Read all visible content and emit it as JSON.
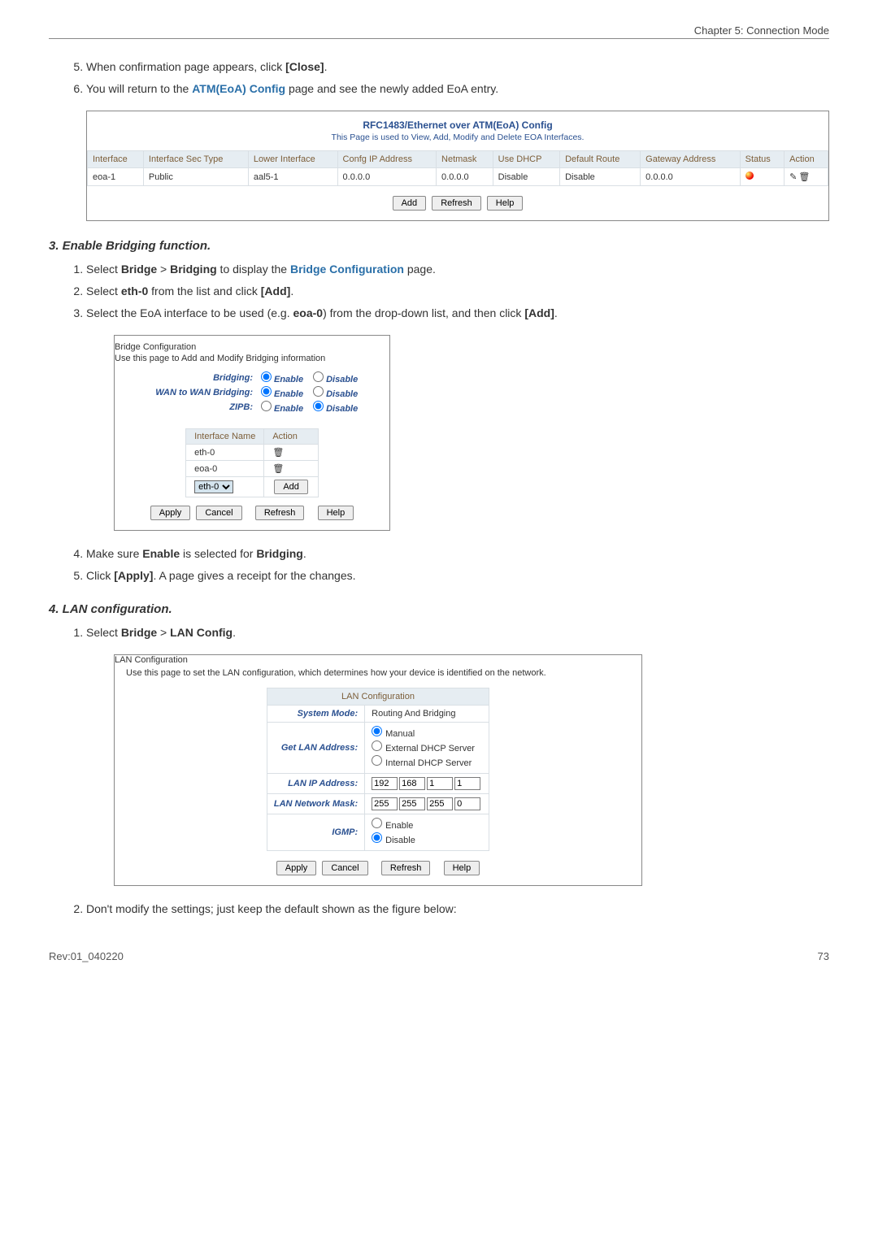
{
  "chapter": "Chapter 5: Connection Mode",
  "steps_top": [
    {
      "num": "5.",
      "prefix": "When confirmation page appears, click ",
      "bold": "[Close]",
      "suffix": "."
    },
    {
      "num": "6.",
      "prefix": "You will return to the ",
      "link": "ATM(EoA) Config",
      "suffix": " page and see the newly added EoA entry."
    }
  ],
  "eoa": {
    "title": "RFC1483/Ethernet over ATM(EoA) Config",
    "subtitle": "This Page is used to View, Add, Modify and Delete EOA Interfaces.",
    "headers": [
      "Interface",
      "Interface Sec Type",
      "Lower Interface",
      "Confg IP Address",
      "Netmask",
      "Use DHCP",
      "Default Route",
      "Gateway Address",
      "Status",
      "Action"
    ],
    "row": {
      "iface": "eoa-1",
      "sec": "Public",
      "lower": "aal5-1",
      "ip": "0.0.0.0",
      "mask": "0.0.0.0",
      "dhcp": "Disable",
      "route": "Disable",
      "gw": "0.0.0.0"
    },
    "buttons": {
      "add": "Add",
      "refresh": "Refresh",
      "help": "Help"
    }
  },
  "section3": {
    "heading": "3. Enable Bridging function.",
    "step1": {
      "p1": "Select ",
      "b1": "Bridge",
      "gt": " > ",
      "b2": "Bridging",
      "p2": " to display the ",
      "link": "Bridge Configuration",
      "p3": " page."
    },
    "step2": {
      "p1": "Select ",
      "b1": "eth-0",
      "p2": " from the list and click ",
      "b2": "[Add]",
      "p3": "."
    },
    "step3": {
      "p1": "Select the EoA interface to be used (e.g. ",
      "b1": "eoa-0",
      "p2": ") from the drop-down list, and then click ",
      "b2": "[Add]",
      "p3": "."
    }
  },
  "bridge": {
    "title": "Bridge Configuration",
    "subtitle": "Use this page to Add and Modify Bridging information",
    "rows": [
      {
        "label": "Bridging:",
        "enable_checked": true
      },
      {
        "label": "WAN to WAN Bridging:",
        "enable_checked": true
      },
      {
        "label": "ZIPB:",
        "enable_checked": false
      }
    ],
    "opt_enable": "Enable",
    "opt_disable": "Disable",
    "iface_table": {
      "headers": [
        "Interface Name",
        "Action"
      ],
      "rows": [
        "eth-0",
        "eoa-0"
      ],
      "select_value": "eth-0"
    },
    "buttons": {
      "apply": "Apply",
      "cancel": "Cancel",
      "refresh": "Refresh",
      "help": "Help",
      "add": "Add"
    }
  },
  "section3b": {
    "step4": {
      "p1": "Make sure ",
      "b1": "Enable",
      "p2": " is selected for ",
      "b2": "Bridging",
      "p3": "."
    },
    "step5": {
      "p1": "Click ",
      "b1": "[Apply]",
      "p2": ". A page gives a receipt for the changes."
    }
  },
  "section4": {
    "heading": "4. LAN configuration.",
    "step1": {
      "p1": "Select ",
      "b1": "Bridge",
      "gt": " > ",
      "b2": "LAN Config",
      "p3": "."
    }
  },
  "lan": {
    "title": "LAN Configuration",
    "subtitle": "Use this page to set the LAN configuration, which determines how your device is identified on the network.",
    "table_header": "LAN Configuration",
    "rows": {
      "mode": {
        "label": "System Mode:",
        "value": "Routing And Bridging"
      },
      "get_addr": {
        "label": "Get LAN Address:",
        "opts": [
          "Manual",
          "External DHCP Server",
          "Internal DHCP Server"
        ],
        "checked": 0
      },
      "ip": {
        "label": "LAN IP Address:",
        "oct": [
          "192",
          "168",
          "1",
          "1"
        ]
      },
      "mask": {
        "label": "LAN Network Mask:",
        "oct": [
          "255",
          "255",
          "255",
          "0"
        ]
      },
      "igmp": {
        "label": "IGMP:",
        "opts": [
          "Enable",
          "Disable"
        ],
        "checked": 1
      }
    },
    "buttons": {
      "apply": "Apply",
      "cancel": "Cancel",
      "refresh": "Refresh",
      "help": "Help"
    }
  },
  "step_final": "Don't modify the settings; just keep the default shown as the figure below:",
  "footer": {
    "left": "Rev:01_040220",
    "right": "73"
  }
}
